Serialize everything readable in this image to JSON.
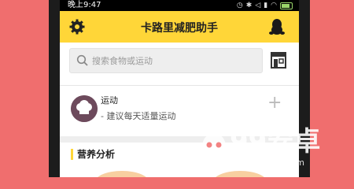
{
  "status": {
    "time": "晚上9:47"
  },
  "header": {
    "title": "卡路里减肥助手",
    "settings_icon": "gear-icon",
    "account_icon": "qq-penguin-icon",
    "bg": "#ffd638"
  },
  "search": {
    "placeholder": "搜索食物或运动",
    "shop_icon": "shop-icon"
  },
  "exercise": {
    "title": "运动",
    "subtitle": "- 建议每天适量运动",
    "add_icon": "plus-icon"
  },
  "nutrition": {
    "title": "营养分析"
  },
  "watermark": {
    "brand": "99安卓",
    "url": "99anzhuo.com"
  }
}
